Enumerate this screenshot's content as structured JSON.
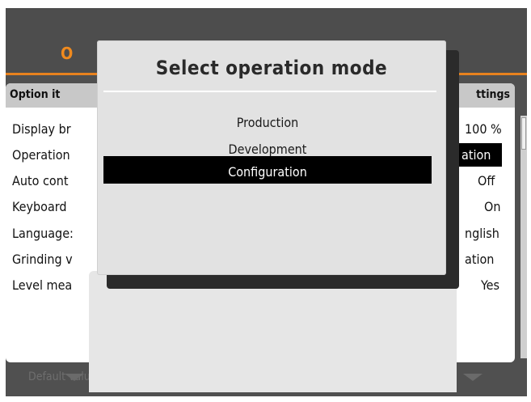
{
  "title": "O",
  "columns": {
    "left": "Option it",
    "right": "ttings"
  },
  "rows": [
    {
      "label": "Display br",
      "value": "100 %"
    },
    {
      "label": "Operation",
      "value": "ation"
    },
    {
      "label": "Auto cont",
      "value": "Off"
    },
    {
      "label": "Keyboard",
      "value": "On"
    },
    {
      "label": "Language:",
      "value": "nglish"
    },
    {
      "label": "Grinding v",
      "value": "ation"
    },
    {
      "label": "Level mea",
      "value": "Yes"
    }
  ],
  "footer": {
    "default_label": "Default value"
  },
  "dialog": {
    "title": "Select operation mode",
    "options": [
      "Production",
      "Development",
      "Configuration"
    ],
    "selected": "Configuration"
  },
  "colors": {
    "accent": "#e8821e",
    "selection": "#000000"
  },
  "icons": {
    "softkey": "triangle-down-icon",
    "scrollbar": "scrollbar"
  }
}
